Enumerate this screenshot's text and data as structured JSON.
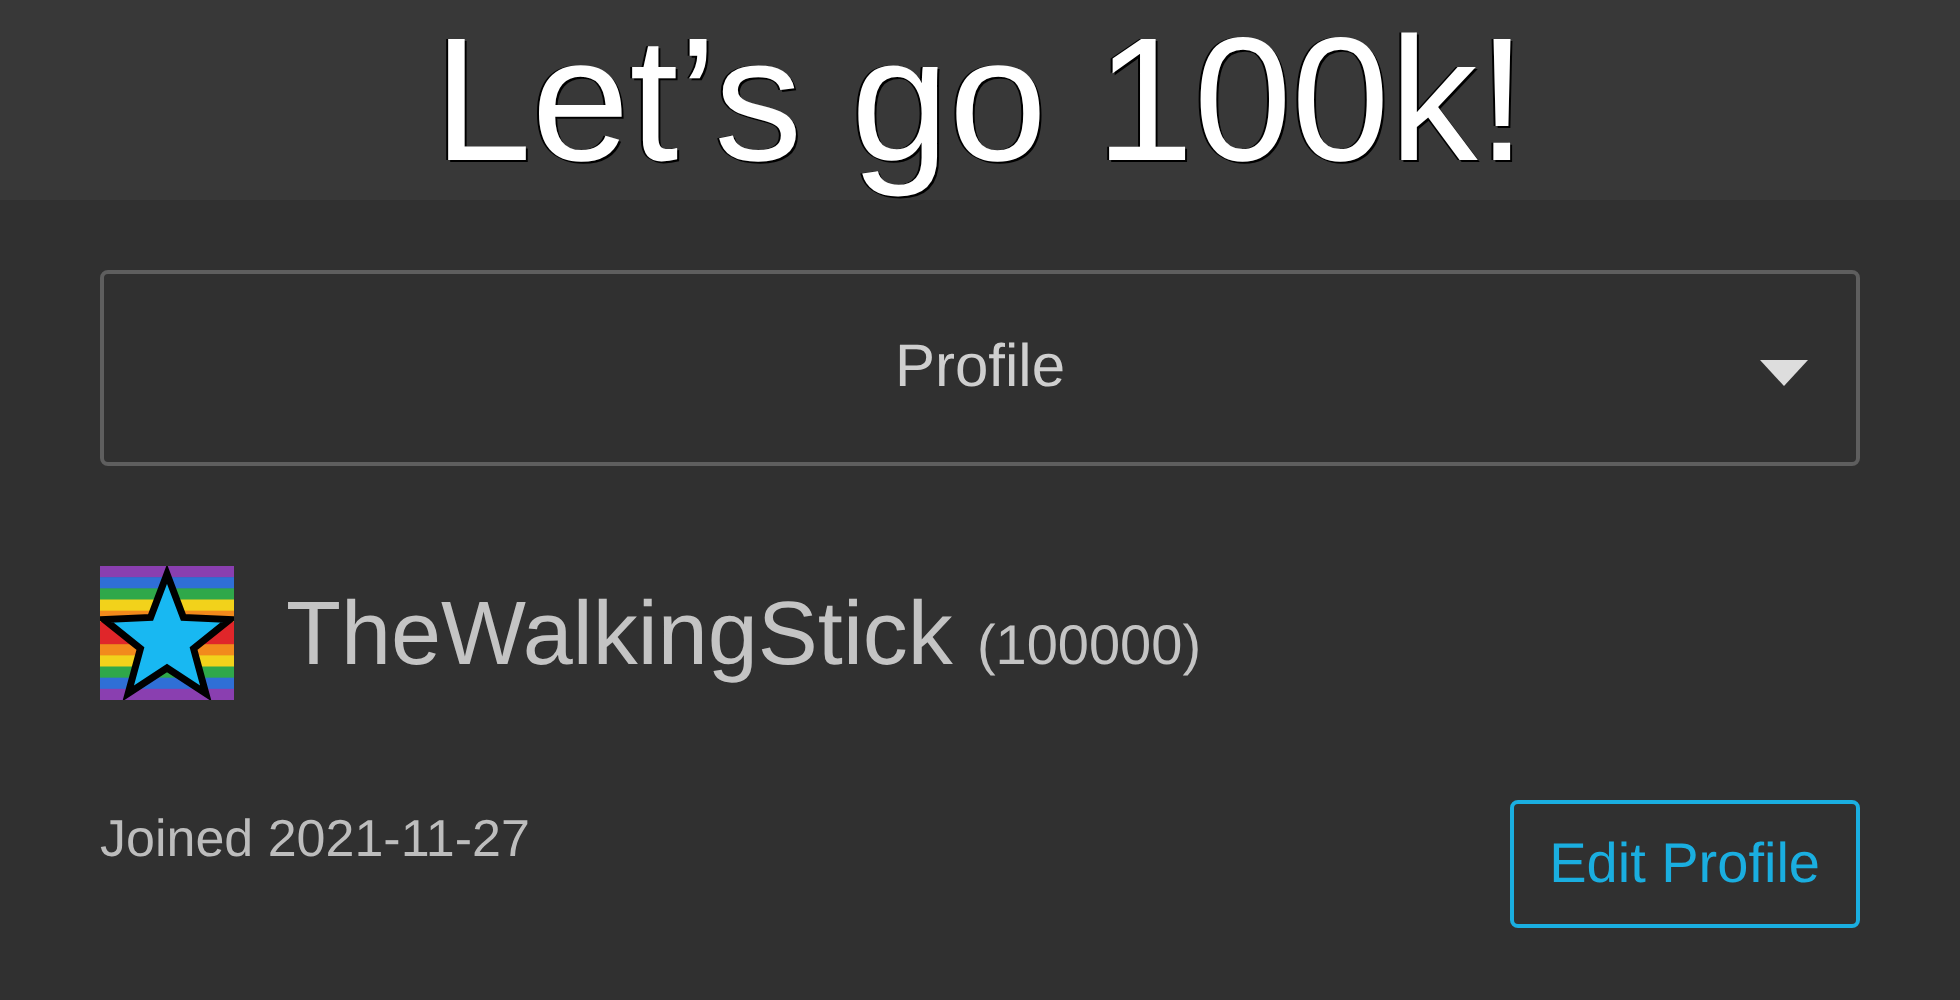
{
  "caption": "Let’s go 100k!",
  "dropdown": {
    "value": "Profile"
  },
  "user": {
    "name": "TheWalkingStick",
    "points": "(100000)"
  },
  "joined": "Joined 2021-11-27",
  "buttons": [
    {
      "label": "Edit Profile"
    }
  ]
}
